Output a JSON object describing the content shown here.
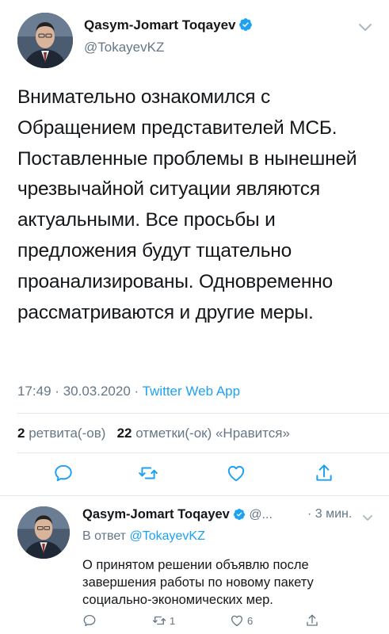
{
  "main_tweet": {
    "author_name": "Qasym-Jomart Toqayev",
    "handle": "@TokayevKZ",
    "text": "Внимательно ознакомился с Обращением представителей МСБ. Поставленные проблемы в нынешней чрезвычайной ситуации являются актуальными. Все просьбы и предложения будут тщательно проанализированы. Одновременно рассматриваются и другие меры.",
    "time": "17:49",
    "date": "30.03.2020",
    "separator": "·",
    "source": "Twitter Web App",
    "retweets_count": "2",
    "retweets_label": "ретвита(-ов)",
    "likes_count": "22",
    "likes_label": "отметки(-ок) «Нравится»"
  },
  "reply_tweet": {
    "author_name": "Qasym-Jomart Toqayev",
    "handle": "@...",
    "time": "· 3 мин.",
    "reply_prefix": "В ответ",
    "reply_to_handle": "@TokayevKZ",
    "text": "О принятом решении объявлю после завершения работы по новому пакету социально-экономических мер.",
    "retweet_count": "1",
    "like_count": "6"
  },
  "icons": {
    "verified": "verified-badge-icon",
    "reply": "comment-icon",
    "retweet": "retweet-icon",
    "like": "heart-icon",
    "share": "share-icon",
    "more": "chevron-down-icon"
  },
  "colors": {
    "accent": "#1da1f2",
    "text": "#14171a",
    "muted": "#657786",
    "divider": "#e1e8ed"
  }
}
